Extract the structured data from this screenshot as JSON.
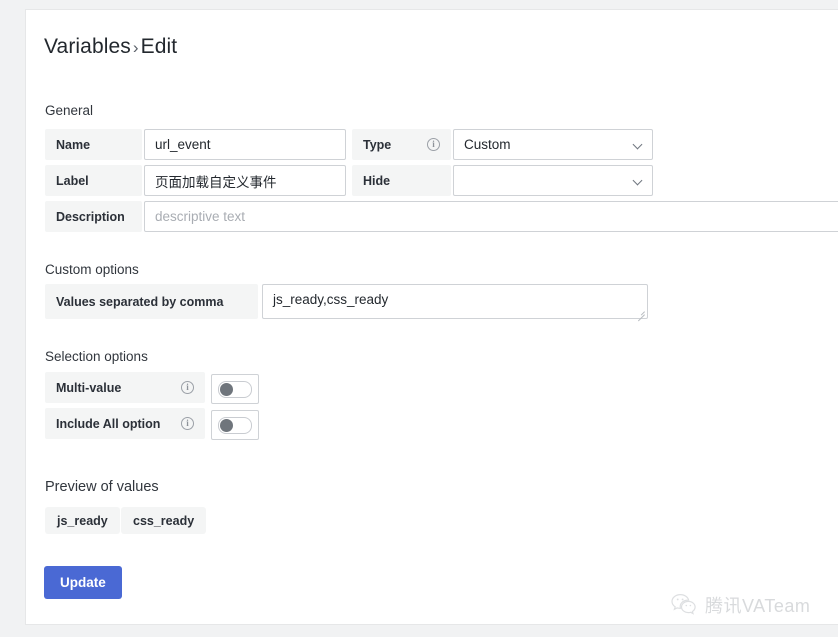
{
  "page": {
    "breadcrumb_root": "Variables",
    "breadcrumb_separator": "›",
    "breadcrumb_current": "Edit"
  },
  "sections": {
    "general": "General",
    "custom_options": "Custom options",
    "selection_options": "Selection options",
    "preview_of_values": "Preview of values"
  },
  "general": {
    "name": {
      "label": "Name",
      "value": "url_event"
    },
    "label": {
      "label": "Label",
      "value": "页面加载自定义事件"
    },
    "description": {
      "label": "Description",
      "value": "",
      "placeholder": "descriptive text"
    },
    "type": {
      "label": "Type",
      "value": "Custom",
      "info_icon": "info-icon"
    },
    "hide": {
      "label": "Hide",
      "value": ""
    }
  },
  "custom_options": {
    "values_label": "Values separated by comma",
    "values_text": "js_ready,css_ready"
  },
  "selection_options": {
    "multi_value": {
      "label": "Multi-value",
      "info_icon": "info-icon",
      "enabled": false
    },
    "include_all": {
      "label": "Include All option",
      "info_icon": "info-icon",
      "enabled": false
    }
  },
  "preview": {
    "values": [
      "js_ready",
      "css_ready"
    ]
  },
  "actions": {
    "update_label": "Update"
  },
  "watermark": {
    "text": "腾讯VATeam",
    "icon": "wechat-logo-icon"
  },
  "colors": {
    "accent": "#4a69d4",
    "page_bg": "#f1f2f3",
    "card_bg": "#ffffff",
    "label_bg": "#f4f5f5",
    "border": "#cfd2d6"
  }
}
